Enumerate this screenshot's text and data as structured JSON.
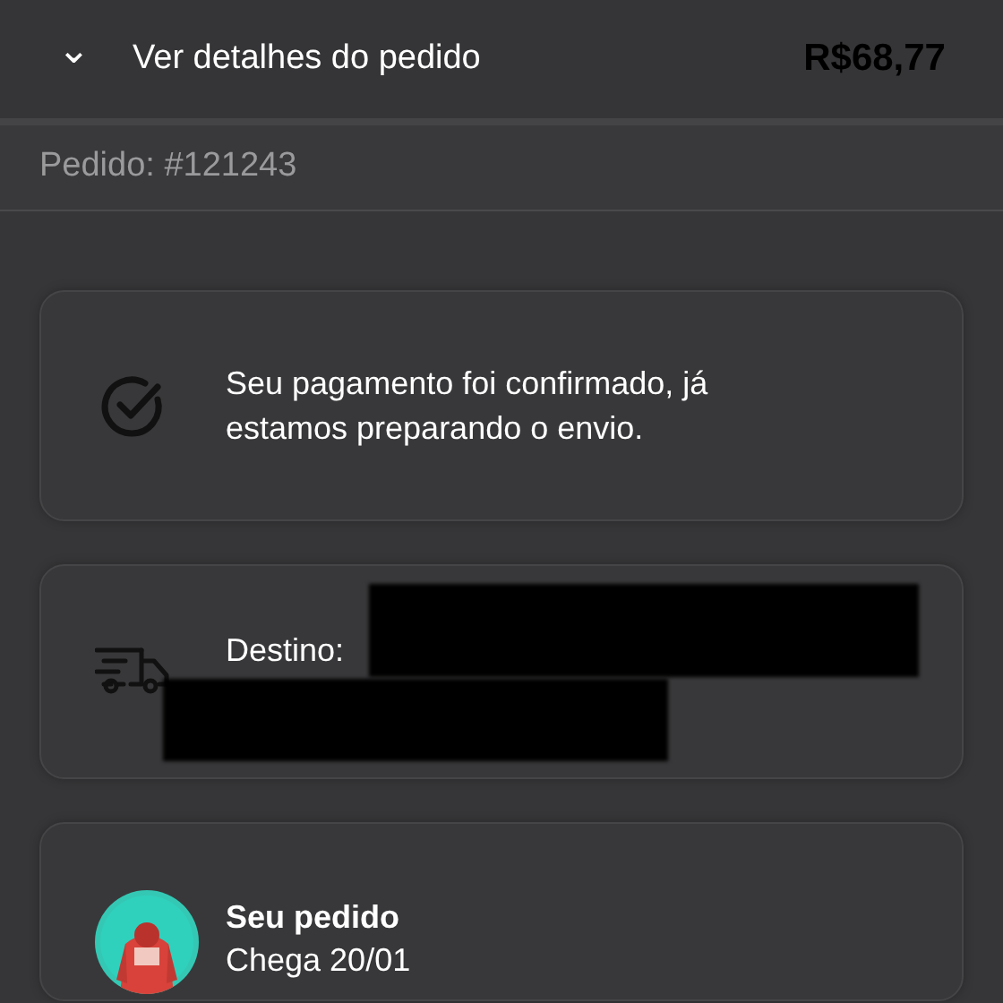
{
  "header": {
    "toggle": "⌄",
    "title": "Ver detalhes do pedido",
    "total": "R$68,77"
  },
  "order": {
    "number": "Pedido: #121243"
  },
  "cards": [
    {
      "kind": "status",
      "text": "Seu pagamento foi confirmado, já estamos preparando o envio."
    },
    {
      "kind": "shipping",
      "label": "Destino:"
    },
    {
      "kind": "item",
      "title": "Seu pedido",
      "subtitle": "Chega 20/01"
    }
  ]
}
